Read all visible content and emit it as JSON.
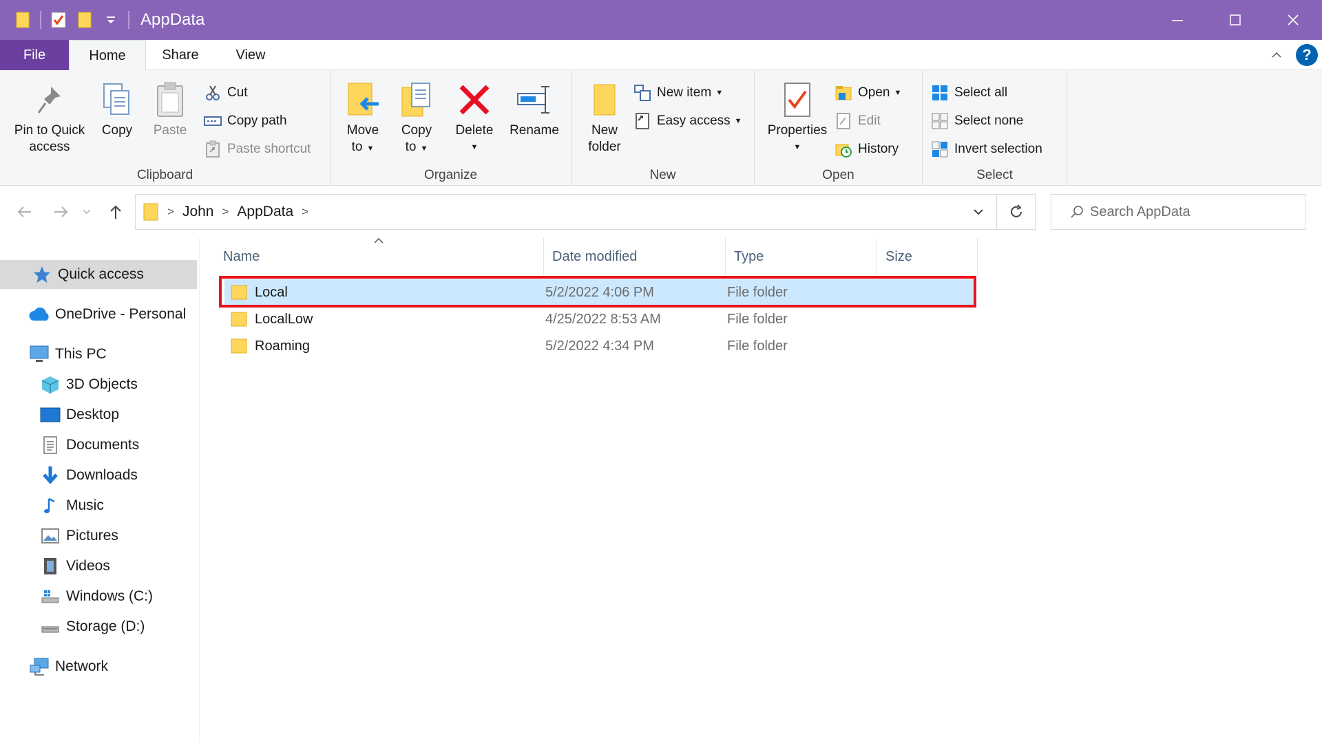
{
  "window": {
    "title": "AppData",
    "title_bar_color": "#8764b8",
    "controls": [
      "minimize",
      "maximize",
      "close"
    ]
  },
  "ribbon": {
    "tabs": {
      "file": "File",
      "home": "Home",
      "share": "Share",
      "view": "View"
    },
    "active_tab": "Home",
    "help": "?",
    "clipboard": {
      "label": "Clipboard",
      "pin": "Pin to Quick access",
      "pin_l1": "Pin to Quick",
      "pin_l2": "access",
      "copy": "Copy",
      "paste": "Paste",
      "cut": "Cut",
      "copy_path": "Copy path",
      "paste_shortcut": "Paste shortcut"
    },
    "organize": {
      "label": "Organize",
      "move_l1": "Move",
      "move_l2": "to",
      "copy_l1": "Copy",
      "copy_l2": "to",
      "delete": "Delete",
      "rename": "Rename"
    },
    "new": {
      "label": "New",
      "folder_l1": "New",
      "folder_l2": "folder",
      "new_item": "New item",
      "easy_access": "Easy access"
    },
    "open": {
      "label": "Open",
      "properties": "Properties",
      "open": "Open",
      "edit": "Edit",
      "history": "History"
    },
    "select": {
      "label": "Select",
      "select_all": "Select all",
      "select_none": "Select none",
      "invert": "Invert selection"
    }
  },
  "address": {
    "breadcrumbs": [
      "John",
      "AppData"
    ],
    "search_placeholder": "Search AppData"
  },
  "nav": {
    "quick_access": "Quick access",
    "onedrive": "OneDrive - Personal",
    "this_pc": "This PC",
    "objects3d": "3D Objects",
    "desktop": "Desktop",
    "documents": "Documents",
    "downloads": "Downloads",
    "music": "Music",
    "pictures": "Pictures",
    "videos": "Videos",
    "windows_c": "Windows (C:)",
    "storage_d": "Storage (D:)",
    "network": "Network"
  },
  "files": {
    "columns": {
      "name": "Name",
      "date": "Date modified",
      "type": "Type",
      "size": "Size"
    },
    "rows": [
      {
        "name": "Local",
        "date": "5/2/2022 4:06 PM",
        "type": "File folder",
        "size": ""
      },
      {
        "name": "LocalLow",
        "date": "4/25/2022 8:53 AM",
        "type": "File folder",
        "size": ""
      },
      {
        "name": "Roaming",
        "date": "5/2/2022 4:34 PM",
        "type": "File folder",
        "size": ""
      }
    ],
    "selected_row": "Local",
    "highlight_color": "#e8141c"
  }
}
